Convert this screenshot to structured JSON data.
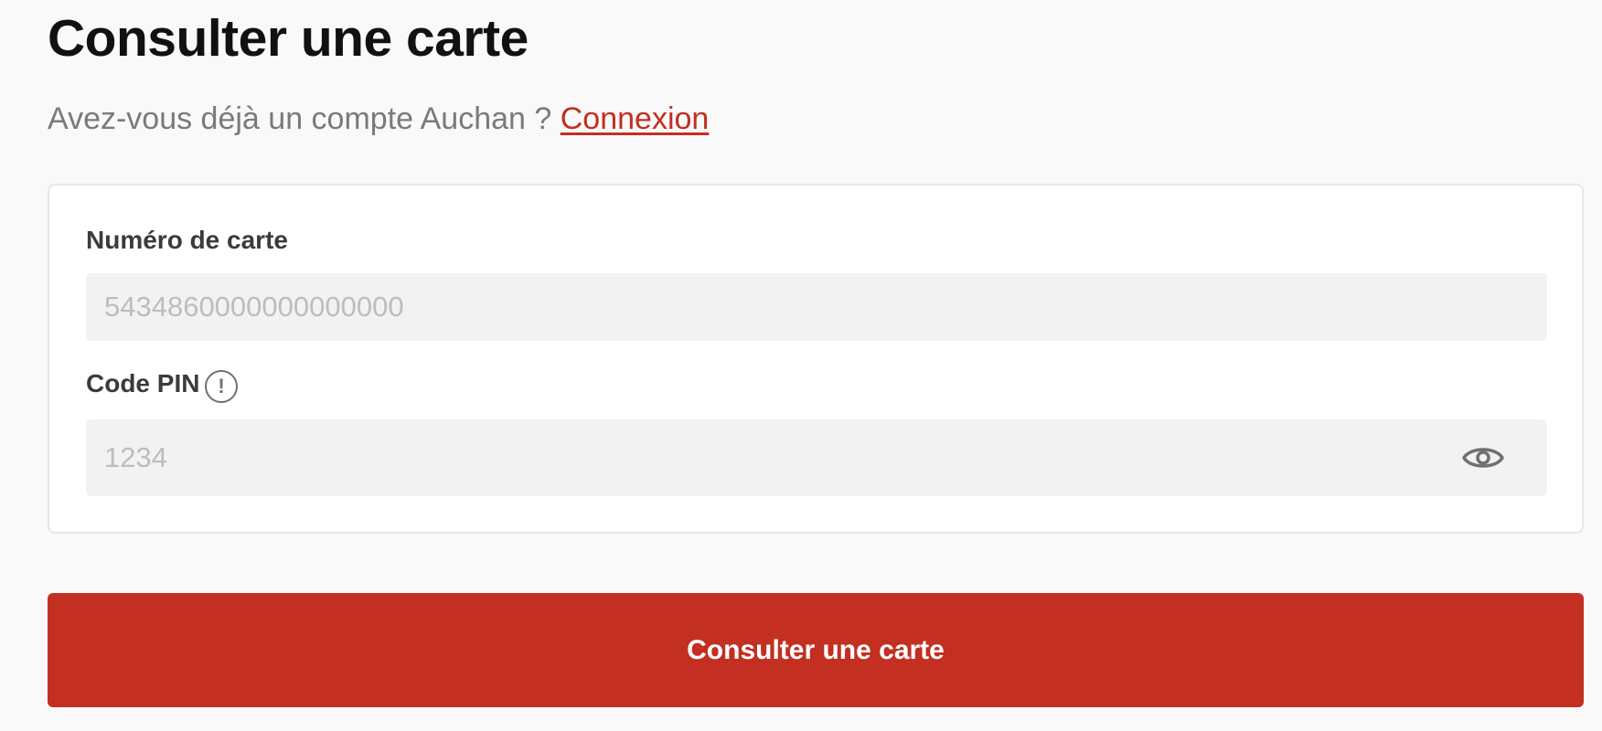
{
  "page": {
    "title": "Consulter une carte",
    "subtitle_text": "Avez-vous déjà un compte Auchan ?",
    "login_link": "Connexion"
  },
  "form": {
    "card_number": {
      "label": "Numéro de carte",
      "placeholder": "5434860000000000000"
    },
    "pin": {
      "label": "Code PIN",
      "info_icon": "exclamation-circle",
      "placeholder": "1234",
      "visibility_icon": "eye"
    },
    "submit_label": "Consulter une carte"
  },
  "colors": {
    "accent": "#c32f20",
    "background": "#f9f9f9",
    "input_background": "#f2f2f2"
  }
}
